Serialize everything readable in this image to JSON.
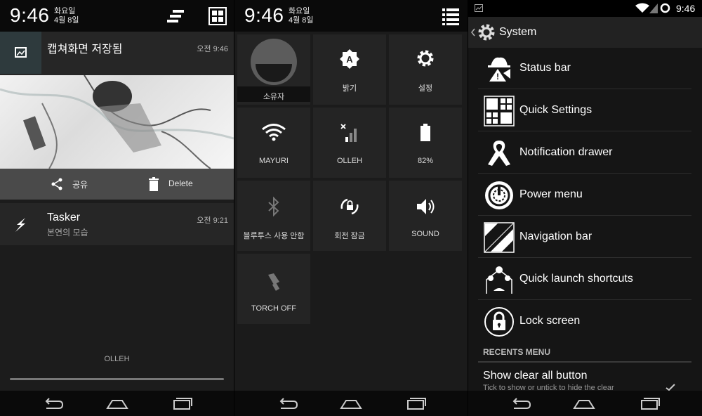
{
  "panel_notifications": {
    "clock": "9:46",
    "weekday": "화요일",
    "date": "4월 8일",
    "notif1": {
      "title": "캡쳐화면 저장됨",
      "time": "오전 9:46",
      "icon": "image-icon"
    },
    "share_label": "공유",
    "delete_label": "Delete",
    "notif2": {
      "title": "Tasker",
      "subtitle": "본연의 모습",
      "time": "오전 9:21",
      "icon": "lightning-icon"
    },
    "carrier": "OLLEH"
  },
  "panel_quick_settings": {
    "clock": "9:46",
    "weekday": "화요일",
    "date": "4월 8일",
    "tiles": [
      {
        "label": "소유자",
        "icon": "user-avatar-icon"
      },
      {
        "label": "밝기",
        "icon": "brightness-auto-icon"
      },
      {
        "label": "설정",
        "icon": "gear-icon"
      },
      {
        "label": "MAYURI",
        "icon": "wifi-icon"
      },
      {
        "label": "OLLEH",
        "icon": "cell-signal-icon"
      },
      {
        "label": "82%",
        "icon": "battery-icon"
      },
      {
        "label": "블루투스 사용 안함",
        "icon": "bluetooth-icon"
      },
      {
        "label": "회전 잠금",
        "icon": "rotation-lock-icon"
      },
      {
        "label": "SOUND",
        "icon": "speaker-icon"
      },
      {
        "label": "TORCH OFF",
        "icon": "flashlight-icon"
      }
    ]
  },
  "panel_settings": {
    "status_time": "9:46",
    "title": "System",
    "items": [
      {
        "label": "Status bar",
        "icon": "status-bar-icon"
      },
      {
        "label": "Quick Settings",
        "icon": "quick-settings-icon"
      },
      {
        "label": "Notification drawer",
        "icon": "notification-drawer-icon"
      },
      {
        "label": "Power menu",
        "icon": "power-menu-icon"
      },
      {
        "label": "Navigation bar",
        "icon": "navigation-bar-icon"
      },
      {
        "label": "Quick launch shortcuts",
        "icon": "quick-launch-icon"
      },
      {
        "label": "Lock screen",
        "icon": "lock-icon"
      }
    ],
    "section_header": "RECENTS MENU",
    "option_label": "Show clear all button",
    "option_sub": "Tick to show or untick to hide the clear"
  },
  "colors": {
    "accent": "#ffffff",
    "background": "#1c1c1c",
    "tile": "#242424"
  }
}
